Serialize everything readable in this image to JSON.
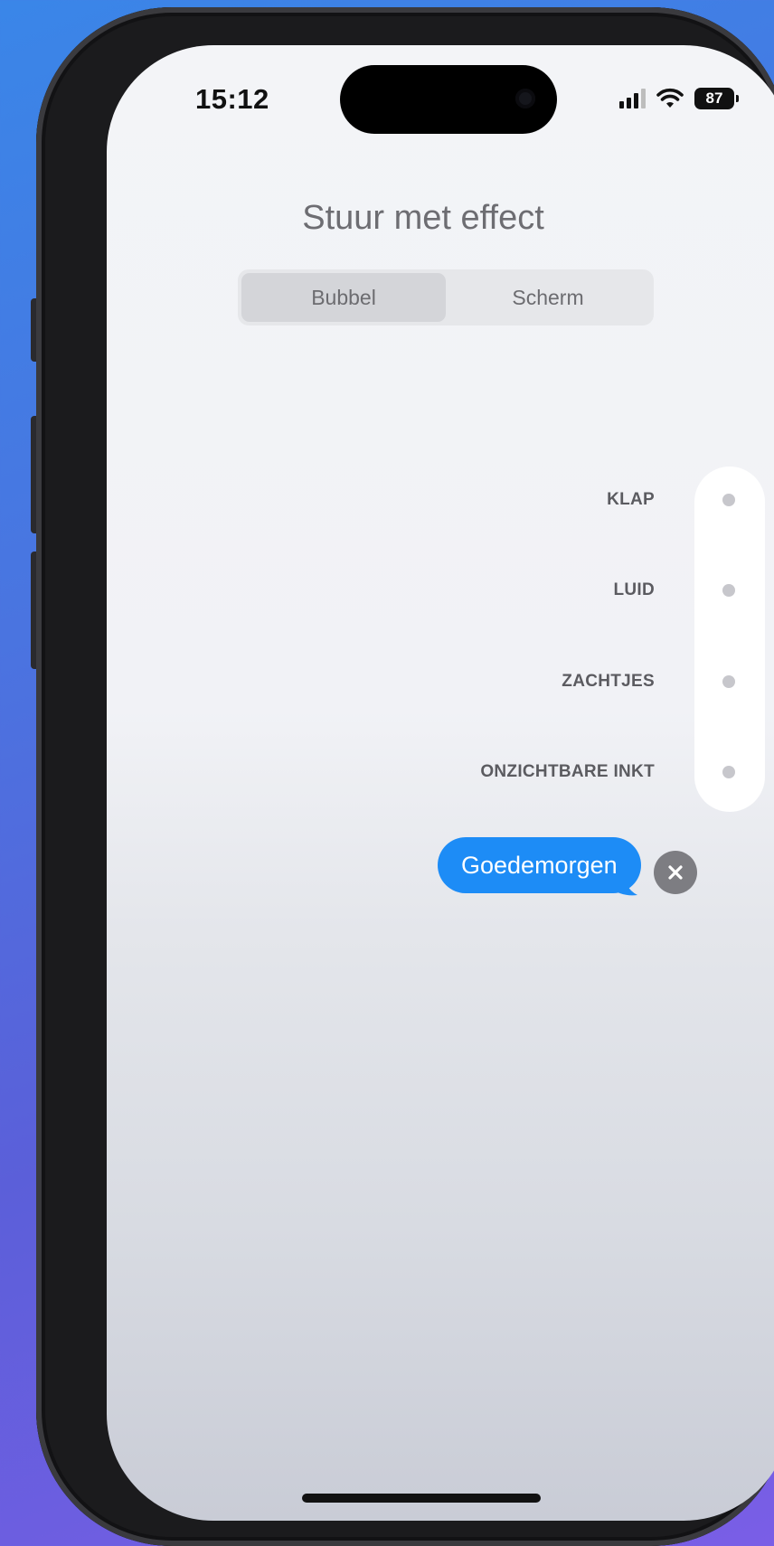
{
  "status_bar": {
    "time": "15:12",
    "battery": "87",
    "signal_icon": "cellular-signal-icon",
    "wifi_icon": "wifi-icon"
  },
  "title": "Stuur met effect",
  "tabs": [
    {
      "label": "Bubbel",
      "active": true
    },
    {
      "label": "Scherm",
      "active": false
    }
  ],
  "effects": [
    {
      "label": "KLAP"
    },
    {
      "label": "LUID"
    },
    {
      "label": "ZACHTJES"
    },
    {
      "label": "ONZICHTBARE INKT"
    }
  ],
  "message": {
    "text": "Goedemorgen"
  },
  "colors": {
    "bubble": "#1d8cf6",
    "close_button": "#7d7d82"
  }
}
